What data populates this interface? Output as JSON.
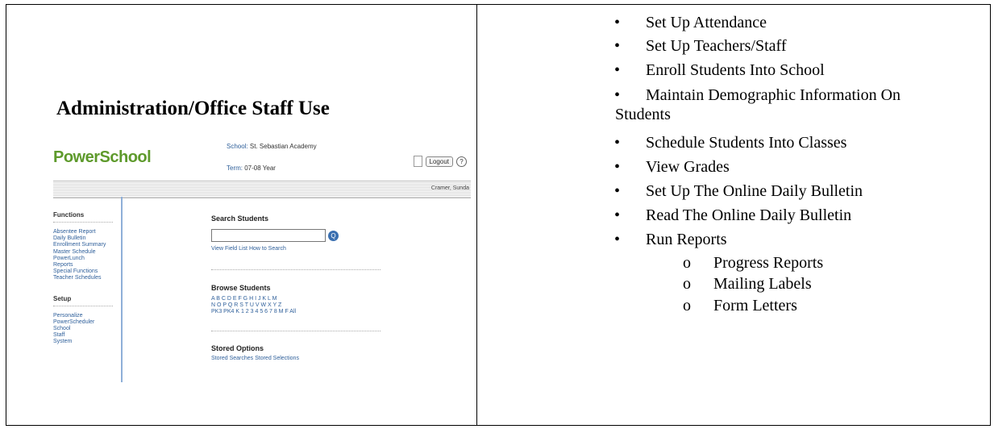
{
  "left": {
    "heading": "Administration/Office Staff Use",
    "screenshot": {
      "logo": "PowerSchool",
      "school_label": "School:",
      "school_value": "St. Sebastian Academy",
      "term_label": "Term:",
      "term_value": "07-08 Year",
      "logout_label": "Logout",
      "help_glyph": "?",
      "user_name": "Cramer, Sunda",
      "functions_title": "Functions",
      "functions": [
        "Absentee Report",
        "Daily Bulletin",
        "Enrollment Summary",
        "Master Schedule",
        "PowerLunch",
        "Reports",
        "Special Functions",
        "Teacher Schedules"
      ],
      "setup_title": "Setup",
      "setup": [
        "Personalize",
        "PowerScheduler",
        "School",
        "Staff",
        "System"
      ],
      "search_title": "Search Students",
      "search_links": "View Field List   How to Search",
      "browse_title": "Browse Students",
      "browse_row1": "A B C D E F G H I J K L M",
      "browse_row2": "N O P Q R S T U V W X Y Z",
      "browse_row3": "PK3 PK4 K 1 2 3 4 5 6 7 8  M  F All",
      "stored_title": "Stored Options",
      "stored_links": "Stored Searches   Stored Selections",
      "search_glyph": "Q"
    }
  },
  "right": {
    "bullet": "•",
    "sub_bullet": "o",
    "items": [
      "Set Up Attendance",
      "Set Up Teachers/Staff",
      "Enroll Students Into School",
      "Maintain Demographic Information On",
      "Schedule Students Into Classes",
      "View Grades",
      "Set Up The Online Daily Bulletin",
      "Read The Online Daily Bulletin",
      "Run Reports"
    ],
    "continuation": "Students",
    "subitems": [
      "Progress Reports",
      "Mailing Labels",
      "Form Letters"
    ]
  }
}
